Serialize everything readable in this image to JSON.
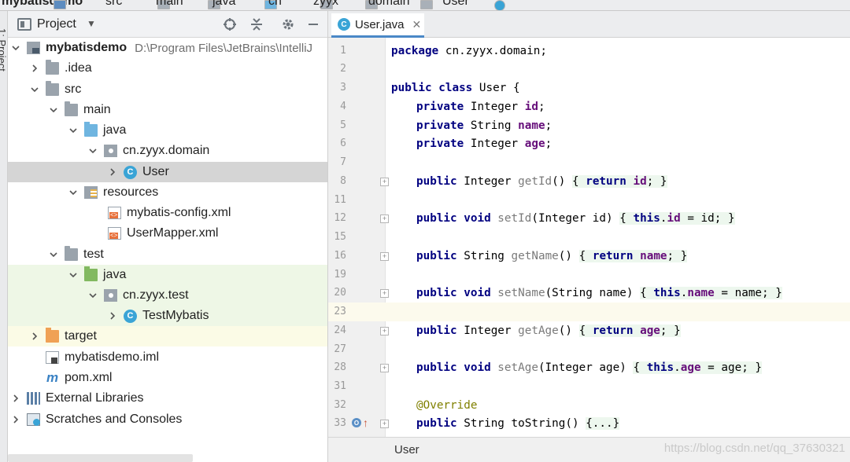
{
  "breadcrumb": [
    {
      "label": "mybatisdemo",
      "bold": true
    },
    {
      "label": "src"
    },
    {
      "label": "main"
    },
    {
      "label": "java"
    },
    {
      "label": "cn"
    },
    {
      "label": "zyyx"
    },
    {
      "label": "domain"
    },
    {
      "label": "User"
    }
  ],
  "side_strip": {
    "label": "1: Project"
  },
  "project_panel": {
    "title": "Project",
    "toolbar": {
      "locate_icon": "crosshair-icon",
      "collapse_icon": "collapse-icon",
      "settings_icon": "gear-icon",
      "hide_icon": "minimize-icon"
    },
    "tree": [
      {
        "label": "mybatisdemo",
        "path": "D:\\Program Files\\JetBrains\\IntelliJ",
        "icon": "module-icon",
        "expanded": true,
        "bold": true
      },
      {
        "label": ".idea",
        "icon": "folder-icon",
        "expanded": false
      },
      {
        "label": "src",
        "icon": "folder-icon",
        "expanded": true
      },
      {
        "label": "main",
        "icon": "folder-icon",
        "expanded": true
      },
      {
        "label": "java",
        "icon": "source-folder-icon",
        "expanded": true
      },
      {
        "label": "cn.zyyx.domain",
        "icon": "package-icon",
        "expanded": true
      },
      {
        "label": "User",
        "icon": "class-icon",
        "expanded": false,
        "selected": true
      },
      {
        "label": "resources",
        "icon": "resources-folder-icon",
        "expanded": true
      },
      {
        "label": "mybatis-config.xml",
        "icon": "xml-file-icon"
      },
      {
        "label": "UserMapper.xml",
        "icon": "xml-file-icon"
      },
      {
        "label": "test",
        "icon": "folder-icon",
        "expanded": true
      },
      {
        "label": "java",
        "icon": "test-folder-icon",
        "expanded": true
      },
      {
        "label": "cn.zyyx.test",
        "icon": "package-icon",
        "expanded": true
      },
      {
        "label": "TestMybatis",
        "icon": "test-class-icon",
        "expanded": false
      },
      {
        "label": "target",
        "icon": "excluded-folder-icon",
        "expanded": false
      },
      {
        "label": "mybatisdemo.iml",
        "icon": "iml-file-icon"
      },
      {
        "label": "pom.xml",
        "icon": "maven-icon"
      },
      {
        "label": "External Libraries",
        "icon": "libraries-icon",
        "expanded": false
      },
      {
        "label": "Scratches and Consoles",
        "icon": "scratches-icon",
        "expanded": false
      }
    ]
  },
  "editor": {
    "tab": {
      "label": "User.java",
      "icon": "class-icon"
    },
    "lines": [
      {
        "n": "1"
      },
      {
        "n": "2"
      },
      {
        "n": "3"
      },
      {
        "n": "4"
      },
      {
        "n": "5"
      },
      {
        "n": "6"
      },
      {
        "n": "7"
      },
      {
        "n": "8"
      },
      {
        "n": "11"
      },
      {
        "n": "12"
      },
      {
        "n": "15"
      },
      {
        "n": "16"
      },
      {
        "n": "19"
      },
      {
        "n": "20"
      },
      {
        "n": "23"
      },
      {
        "n": "24"
      },
      {
        "n": "27"
      },
      {
        "n": "28"
      },
      {
        "n": "31"
      },
      {
        "n": "32"
      },
      {
        "n": "33"
      }
    ],
    "code": {
      "l1_kw": "package",
      "l1_rest": " cn.zyyx.domain;",
      "l3_kw": "public class",
      "l3_rest": " User {",
      "l4_kw": "private",
      "l4_type": " Integer ",
      "l4_fld": "id",
      "l4_end": ";",
      "l5_kw": "private",
      "l5_type": " String ",
      "l5_fld": "name",
      "l5_end": ";",
      "l6_kw": "private",
      "l6_type": " Integer ",
      "l6_fld": "age",
      "l6_end": ";",
      "l8_kw": "public",
      "l8_type": " Integer ",
      "l8_m": "getId",
      "l8_p": "() ",
      "l8_b1": "{ ",
      "l8_kw2": "return",
      "l8_sp": " ",
      "l8_fld": "id",
      "l8_b2": "; }",
      "l12_kw": "public void",
      "l12_sp": " ",
      "l12_m": "setId",
      "l12_p": "(Integer id) ",
      "l12_b1": "{ ",
      "l12_kw2": "this",
      "l12_dot": ".",
      "l12_fld": "id",
      "l12_b2": " = id; }",
      "l16_kw": "public",
      "l16_type": " String ",
      "l16_m": "getName",
      "l16_p": "() ",
      "l16_b1": "{ ",
      "l16_kw2": "return",
      "l16_sp": " ",
      "l16_fld": "name",
      "l16_b2": "; }",
      "l20_kw": "public void",
      "l20_sp": " ",
      "l20_m": "setName",
      "l20_p": "(String name) ",
      "l20_b1": "{ ",
      "l20_kw2": "this",
      "l20_dot": ".",
      "l20_fld": "name",
      "l20_b2": " = name; }",
      "l24_kw": "public",
      "l24_type": " Integer ",
      "l24_m": "getAge",
      "l24_p": "() ",
      "l24_b1": "{ ",
      "l24_kw2": "return",
      "l24_sp": " ",
      "l24_fld": "age",
      "l24_b2": "; }",
      "l28_kw": "public void",
      "l28_sp": " ",
      "l28_m": "setAge",
      "l28_p": "(Integer age) ",
      "l28_b1": "{ ",
      "l28_kw2": "this",
      "l28_dot": ".",
      "l28_fld": "age",
      "l28_b2": " = age; }",
      "l32_ann": "@Override",
      "l33_kw": "public",
      "l33_rest": " String toString() ",
      "l33_blk": "{...}"
    },
    "current_line": "23"
  },
  "status_bar": {
    "breadcrumb": "User",
    "watermark": "https://blog.csdn.net/qq_37630321"
  },
  "colors": {
    "keyword": "#000080",
    "field": "#660e7a",
    "annotation": "#808000",
    "selection": "#d5d5d5",
    "test_bg": "#eef7e6",
    "caret_line": "#fcfaed"
  }
}
